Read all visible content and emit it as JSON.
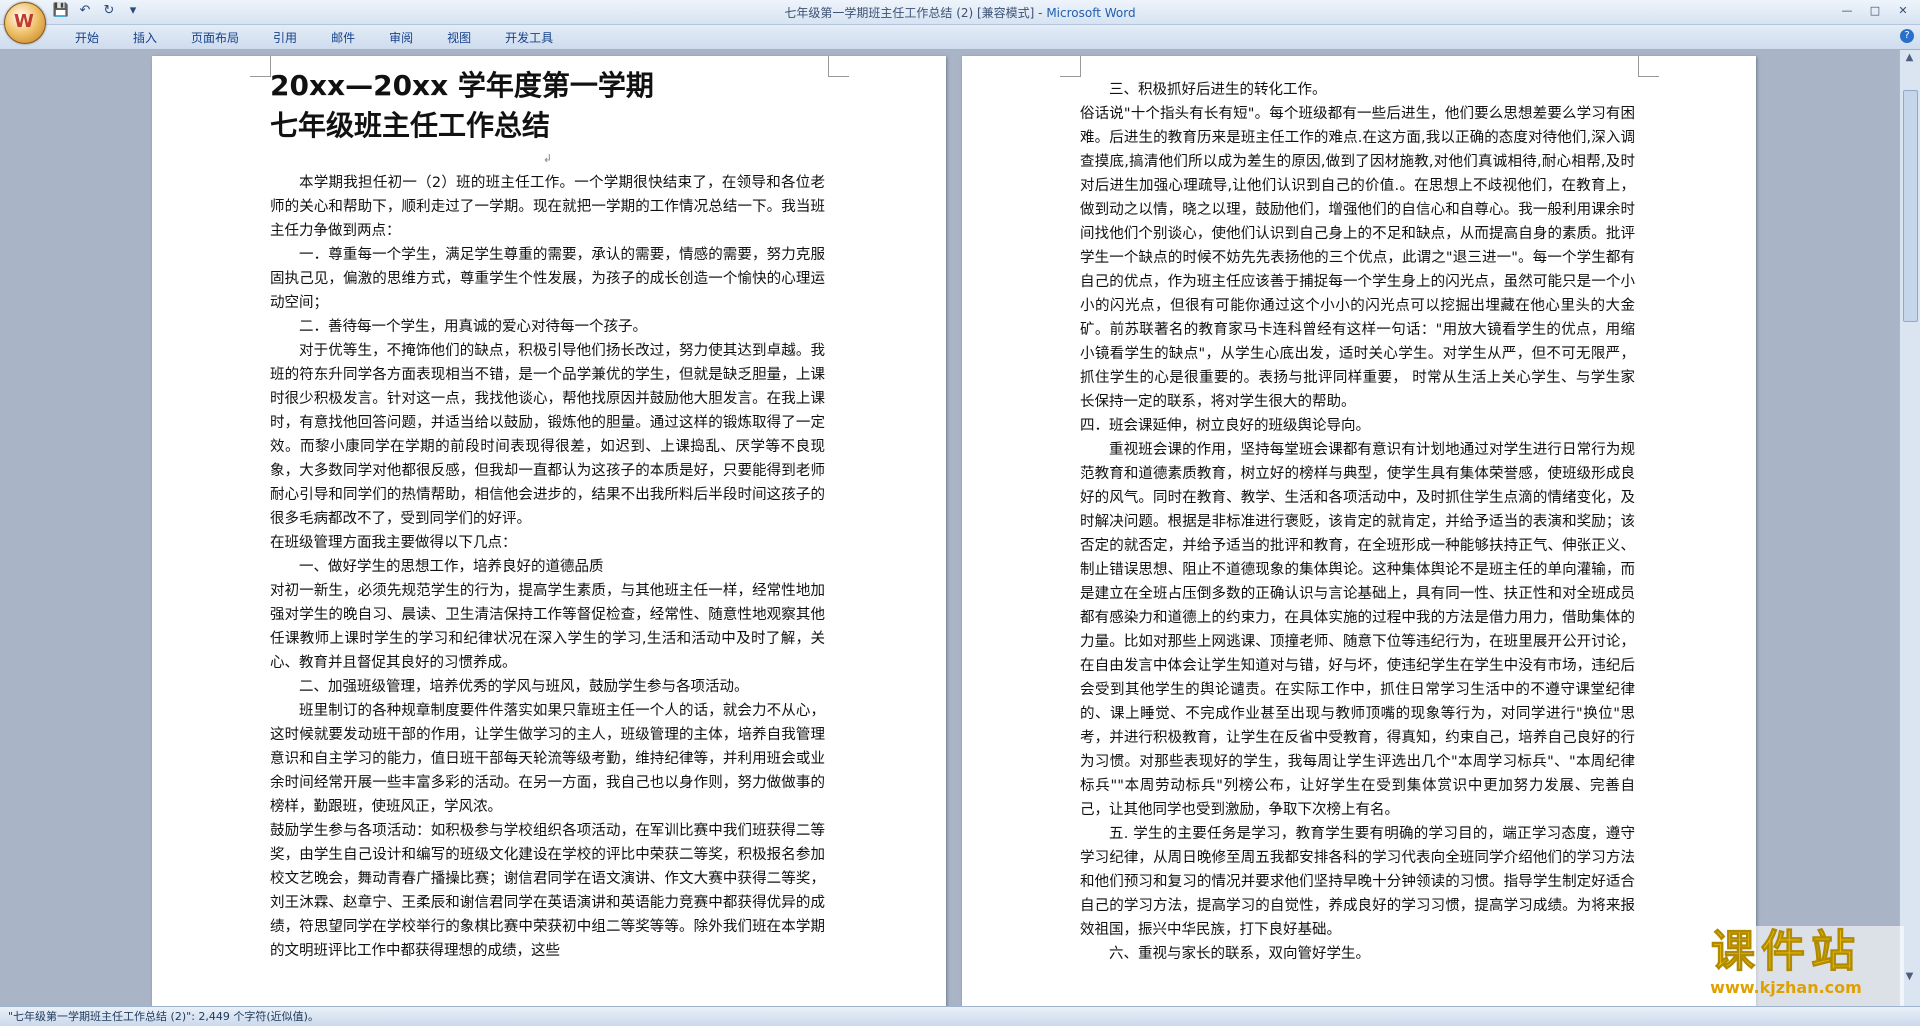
{
  "window": {
    "title": "七年级第一学期班主任工作总结 (2) [兼容模式] - ",
    "app": "Microsoft Word"
  },
  "ribbon": {
    "tabs": [
      "开始",
      "插入",
      "页面布局",
      "引用",
      "邮件",
      "审阅",
      "视图",
      "开发工具"
    ]
  },
  "page1": {
    "title1": "20xx—20xx 学年度第一学期",
    "title2": "七年级班主任工作总结",
    "paragraphs": [
      "本学期我担任初一（2）班的班主任工作。一个学期很快结束了，在领导和各位老师的关心和帮助下，顺利走过了一学期。现在就把一学期的工作情况总结一下。我当班主任力争做到两点：",
      "一．尊重每一个学生，满足学生尊重的需要，承认的需要，情感的需要，努力克服固执己见，偏激的思维方式，尊重学生个性发展，为孩子的成长创造一个愉快的心理运动空间；",
      "二．善待每一个学生，用真诚的爱心对待每一个孩子。",
      "对于优等生，不掩饰他们的缺点，积极引导他们扬长改过，努力使其达到卓越。我班的符东升同学各方面表现相当不错，是一个品学兼优的学生，但就是缺乏胆量，上课时很少积极发言。针对这一点，我找他谈心，帮他找原因并鼓励他大胆发言。在我上课时，有意找他回答问题，并适当给以鼓励，锻炼他的胆量。通过这样的锻炼取得了一定效。而黎小康同学在学期的前段时间表现得很差，如迟到、上课捣乱、厌学等不良现象，大多数同学对他都很反感，但我却一直都认为这孩子的本质是好，只要能得到老师耐心引导和同学们的热情帮助，相信他会进步的，结果不出我所料后半段时间这孩子的很多毛病都改不了，受到同学们的好评。",
      "在班级管理方面我主要做得以下几点：",
      "一、做好学生的思想工作，培养良好的道德品质",
      "对初一新生，必须先规范学生的行为，提高学生素质，与其他班主任一样，经常性地加强对学生的晚自习、晨读、卫生清洁保持工作等督促检查，经常性、随意性地观察其他任课教师上课时学生的学习和纪律状况在深入学生的学习,生活和活动中及时了解，关心、教育并且督促其良好的习惯养成。",
      "二、加强班级管理，培养优秀的学风与班风，鼓励学生参与各项活动。",
      "班里制订的各种规章制度要件件落实如果只靠班主任一个人的话，就会力不从心，这时候就要发动班干部的作用，让学生做学习的主人，班级管理的主体，培养自我管理意识和自主学习的能力，值日班干部每天轮流等级考勤，维持纪律等，并利用班会或业余时间经常开展一些丰富多彩的活动。在另一方面，我自己也以身作则，努力做做事的榜样，勤跟班，使班风正，学风浓。",
      "鼓励学生参与各项活动：如积极参与学校组织各项活动，在军训比赛中我们班获得二等奖，由学生自己设计和编写的班级文化建设在学校的评比中荣获二等奖，积极报名参加校文艺晚会，舞动青春广播操比赛；谢信君同学在语文演讲、作文大赛中获得二等奖，刘王沐霖、赵章宁、王柔辰和谢信君同学在英语演讲和英语能力竞赛中都获得优异的成绩，符思望同学在学校举行的象棋比赛中荣获初中组二等奖等等。除外我们班在本学期的文明班评比工作中都获得理想的成绩，这些"
    ]
  },
  "page2": {
    "paragraphs": [
      "三、积极抓好后进生的转化工作。",
      "俗话说\"十个指头有长有短\"。每个班级都有一些后进生，他们要么思想差要么学习有困难。后进生的教育历来是班主任工作的难点.在这方面,我以正确的态度对待他们,深入调查摸底,搞清他们所以成为差生的原因,做到了因材施教,对他们真诚相待,耐心相帮,及时对后进生加强心理疏导,让他们认识到自己的价值.。在思想上不歧视他们，在教育上，做到动之以情，晓之以理，鼓励他们，增强他们的自信心和自尊心。我一般利用课余时间找他们个别谈心，使他们认识到自己身上的不足和缺点，从而提高自身的素质。批评学生一个缺点的时候不妨先先表扬他的三个优点，此谓之\"退三进一\"。每一个学生都有自己的优点，作为班主任应该善于捕捉每一个学生身上的闪光点，虽然可能只是一个小小的闪光点，但很有可能你通过这个小小的闪光点可以挖掘出埋藏在他心里头的大金矿。前苏联著名的教育家马卡连科曾经有这样一句话：\"用放大镜看学生的优点，用缩小镜看学生的缺点\"，从学生心底出发，适时关心学生。对学生从严，但不可无限严，抓住学生的心是很重要的。表扬与批评同样重要，  时常从生活上关心学生、与学生家长保持一定的联系，将对学生很大的帮助。",
      "四．班会课延伸，树立良好的班级舆论导向。",
      "重视班会课的作用，坚持每堂班会课都有意识有计划地通过对学生进行日常行为规范教育和道德素质教育，树立好的榜样与典型，使学生具有集体荣誉感，使班级形成良好的风气。同时在教育、教学、生活和各项活动中，及时抓住学生点滴的情绪变化，及时解决问题。根据是非标准进行褒贬，该肯定的就肯定，并给予适当的表演和奖励；该否定的就否定，并给予适当的批评和教育，在全班形成一种能够扶持正气、伸张正义、制止错误思想、阻止不道德现象的集体舆论。这种集体舆论不是班主任的单向灌输，而是建立在全班占压倒多数的正确认识与言论基础上，具有同一性、扶正性和对全班成员都有感染力和道德上的约束力，在具体实施的过程中我的方法是借力用力，借助集体的力量。比如对那些上网逃课、顶撞老师、随意下位等违纪行为，在班里展开公开讨论，在自由发言中体会让学生知道对与错，好与坏，使违纪学生在学生中没有市场，违纪后会受到其他学生的舆论谴责。在实际工作中，抓住日常学习生活中的不遵守课堂纪律的、课上睡觉、不完成作业甚至出现与教师顶嘴的现象等行为，对同学进行\"换位\"思考，并进行积极教育，让学生在反省中受教育，得真知，约束自己，培养自己良好的行为习惯。对那些表现好的学生，我每周让学生评选出几个\"本周学习标兵\"、\"本周纪律标兵\"\"本周劳动标兵\"列榜公布，让好学生在受到集体赏识中更加努力发展、完善自己，让其他同学也受到激励，争取下次榜上有名。",
      "五. 学生的主要任务是学习，教育学生要有明确的学习目的，端正学习态度，遵守学习纪律，从周日晚修至周五我都安排各科的学习代表向全班同学介绍他们的学习方法和他们预习和复习的情况并要求他们坚持早晚十分钟领读的习惯。指导学生制定好适合自己的学习方法，提高学习的自觉性，养成良好的学习习惯，提高学习成绩。为将来报效祖国，振兴中华民族，打下良好基础。",
      "六、重视与家长的联系，双向管好学生。"
    ]
  },
  "status": {
    "text": "\"七年级第一学期班主任工作总结 (2)\": 2,449 个字符(近似值)。"
  },
  "watermark": {
    "big": "课件站",
    "url": "www.kjzhan.com"
  }
}
